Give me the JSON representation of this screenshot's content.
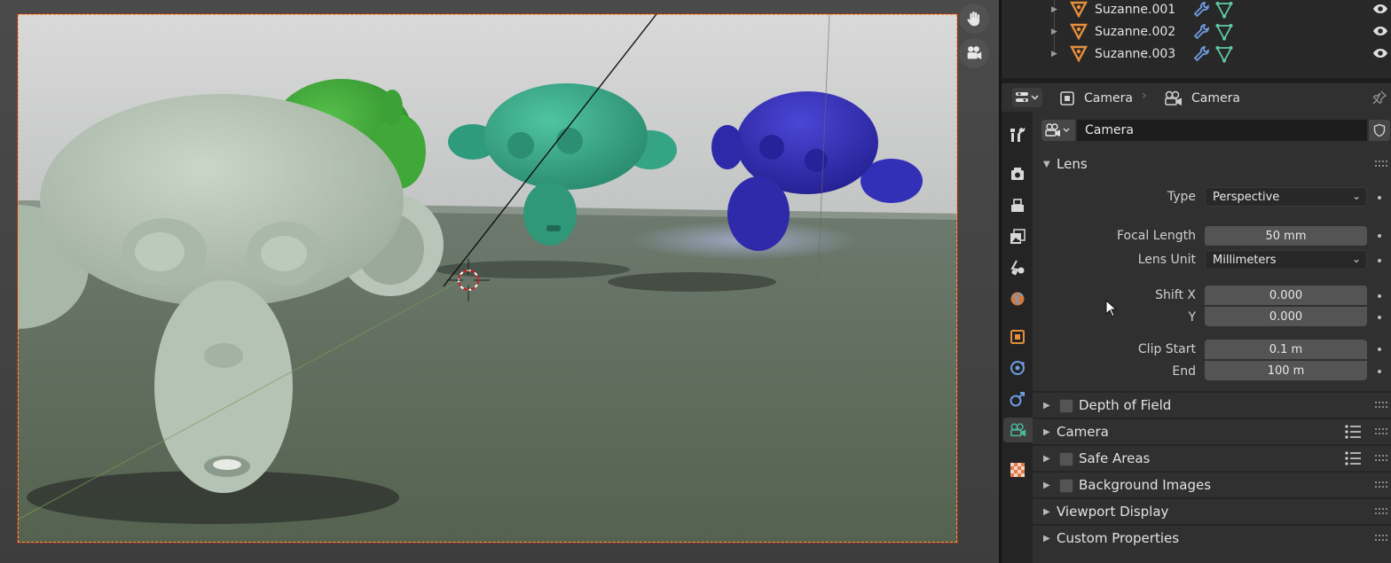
{
  "outliner": {
    "items": [
      {
        "name": "Suzanne.001"
      },
      {
        "name": "Suzanne.002"
      },
      {
        "name": "Suzanne.003"
      }
    ]
  },
  "properties_header": {
    "breadcrumb": [
      "Camera",
      "Camera"
    ]
  },
  "datablock": {
    "name": "Camera"
  },
  "lens": {
    "title": "Lens",
    "type_label": "Type",
    "type_value": "Perspective",
    "focal_label": "Focal Length",
    "focal_value": "50 mm",
    "unit_label": "Lens Unit",
    "unit_value": "Millimeters",
    "shiftx_label": "Shift X",
    "shiftx_value": "0.000",
    "shifty_label": "Y",
    "shifty_value": "0.000",
    "clipstart_label": "Clip Start",
    "clipstart_value": "0.1 m",
    "clipend_label": "End",
    "clipend_value": "100 m"
  },
  "panels": {
    "dof": "Depth of Field",
    "camera": "Camera",
    "safe": "Safe Areas",
    "bg": "Background Images",
    "viewport": "Viewport Display",
    "custom": "Custom Properties"
  },
  "colors": {
    "accent_orange": "#e58e3b",
    "modifier_blue": "#6d9de0",
    "mesh_green": "#5ec9a5",
    "active_tab_green": "#4cb89a"
  }
}
